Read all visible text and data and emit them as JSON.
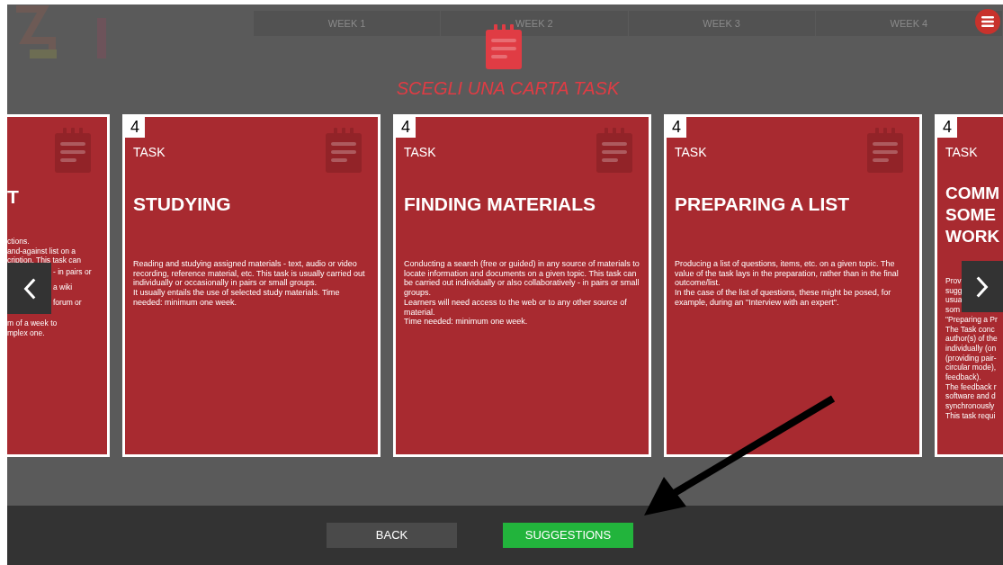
{
  "background_tabs": [
    "WEEK 1",
    "WEEK 2",
    "WEEK 3",
    "WEEK 4"
  ],
  "heading": "SCEGLI UNA CARTA TASK",
  "cards": [
    {
      "kind": "clipped_left",
      "title_lines": [
        "T"
      ],
      "lines_above": [
        "ctions.",
        "and-against list on a",
        "cription. This task can"
      ],
      "lines_beside": [
        "- in pairs or",
        "a wiki",
        "forum or"
      ],
      "lines_below": [
        "m of a week to",
        "mplex one."
      ]
    },
    {
      "kind": "full",
      "number": "4",
      "type_label": "TASK",
      "title_lines": [
        "STUDYING"
      ],
      "lines": [
        "Reading and studying assigned materials - text, audio or video recording, reference material, etc. This task is usually carried out individually or occasionally in pairs or small groups.",
        "It usually entails the use of selected study materials. Time needed: minimum one week."
      ]
    },
    {
      "kind": "full",
      "number": "4",
      "type_label": "TASK",
      "title_lines": [
        "FINDING MATERIALS"
      ],
      "lines": [
        "Conducting a search (free or guided) in any source of materials to locate information and documents on a given topic. This task can be carried out individually or also collaboratively - in pairs or small groups.",
        "Learners will need access to the web or to any other source of material.",
        "Time needed: minimum one week."
      ]
    },
    {
      "kind": "full",
      "number": "4",
      "type_label": "TASK",
      "title_lines": [
        "PREPARING A LIST"
      ],
      "lines": [
        "Producing a list of questions, items, etc. on a given topic. The value of the task lays in the preparation, rather than in the final outcome/list.",
        "In the case of the list of questions, these might be posed, for example, during an \"Interview with an expert\"."
      ]
    },
    {
      "kind": "clipped_right",
      "number": "4",
      "type_label": "TASK",
      "title_lines": [
        "COMM",
        "SOME",
        "WORK"
      ],
      "lines": [
        "Prov",
        "sugg",
        "usua",
        "som",
        "\"Preparing a Pr",
        "The Task conc",
        "author(s) of the",
        "individually (on",
        "(providing pair-",
        "circular mode),",
        "feedback).",
        "The feedback r",
        "software and d",
        "synchronously",
        "This task requi"
      ]
    }
  ],
  "buttons": [
    {
      "label": "BACK",
      "kind": "secondary"
    },
    {
      "label": "SUGGESTIONS",
      "kind": "primary"
    }
  ]
}
